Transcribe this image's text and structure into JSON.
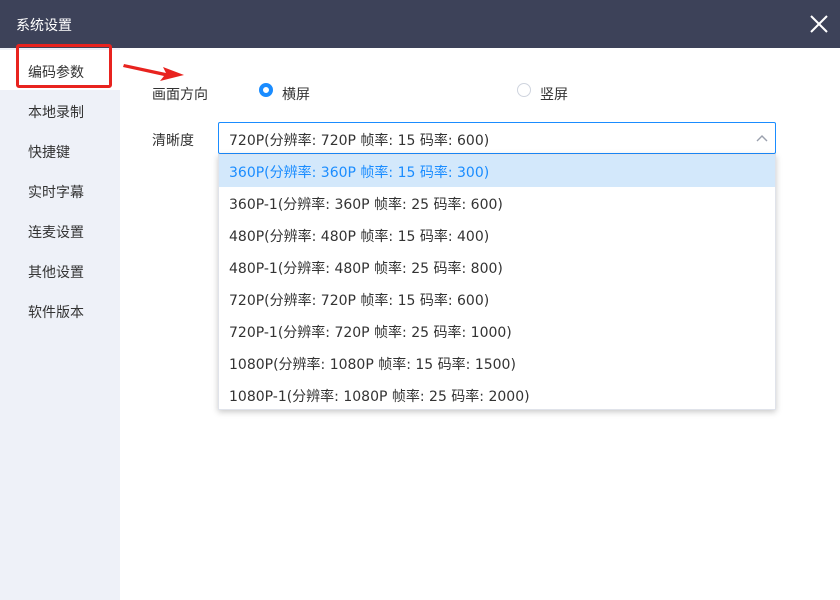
{
  "window": {
    "title": "系统设置"
  },
  "sidebar": {
    "items": [
      {
        "label": "编码参数",
        "active": true
      },
      {
        "label": "本地录制"
      },
      {
        "label": "快捷键"
      },
      {
        "label": "实时字幕"
      },
      {
        "label": "连麦设置"
      },
      {
        "label": "其他设置"
      },
      {
        "label": "软件版本"
      }
    ]
  },
  "orientation": {
    "label": "画面方向",
    "options": [
      {
        "label": "横屏",
        "checked": true
      },
      {
        "label": "竖屏",
        "checked": false
      }
    ]
  },
  "resolution": {
    "label": "清晰度",
    "value": "720P(分辨率: 720P  帧率: 15 码率: 600)",
    "options": [
      "360P(分辨率: 360P  帧率: 15 码率: 300)",
      "360P-1(分辨率: 360P  帧率: 25 码率: 600)",
      "480P(分辨率: 480P  帧率: 15 码率: 400)",
      "480P-1(分辨率: 480P  帧率: 25 码率: 800)",
      "720P(分辨率: 720P  帧率: 15 码率: 600)",
      "720P-1(分辨率: 720P  帧率: 25 码率: 1000)",
      "1080P(分辨率: 1080P  帧率: 15 码率: 1500)",
      "1080P-1(分辨率: 1080P  帧率: 25 码率: 2000)"
    ],
    "highlighted_index": 0
  },
  "colors": {
    "titlebar": "#3d4259",
    "accent": "#1a8cff",
    "annotation": "#e8231f"
  },
  "icons": {
    "close": "close-icon",
    "chevron": "chevron-up-icon",
    "annotation_arrow": "arrow-right-icon"
  }
}
